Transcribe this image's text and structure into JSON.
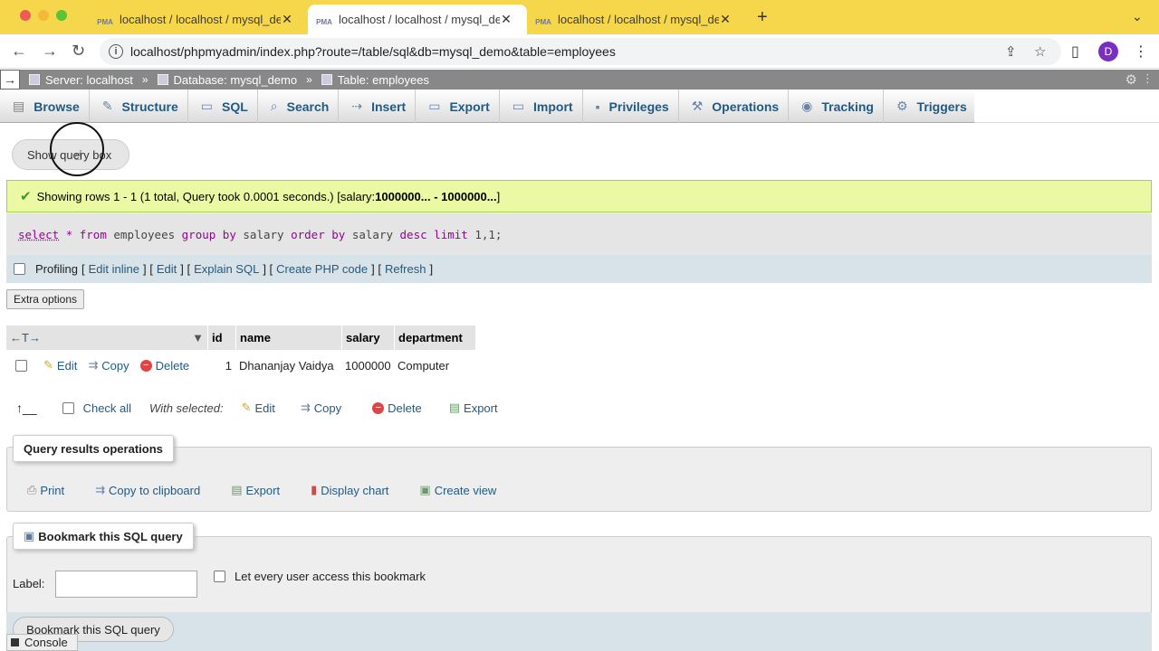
{
  "browser": {
    "tabs": [
      {
        "title": "localhost / localhost / mysql_de",
        "active": false
      },
      {
        "title": "localhost / localhost / mysql_de",
        "active": true
      },
      {
        "title": "localhost / localhost / mysql_de",
        "active": false
      }
    ],
    "favicon_text": "PMA",
    "url": "localhost/phpmyadmin/index.php?route=/table/sql&db=mysql_demo&table=employees",
    "profile_initial": "D"
  },
  "breadcrumb": {
    "server": "Server: localhost",
    "database": "Database: mysql_demo",
    "table": "Table: employees"
  },
  "pma_tabs": [
    "Browse",
    "Structure",
    "SQL",
    "Search",
    "Insert",
    "Export",
    "Import",
    "Privileges",
    "Operations",
    "Tracking",
    "Triggers"
  ],
  "show_query_label": "Show query box",
  "success": {
    "text": "Showing rows 1 - 1 (1 total, Query took 0.0001 seconds.) [salary: ",
    "range": "1000000... - 1000000...",
    "close": "]"
  },
  "sql": {
    "t1": "select",
    "t2": "*",
    "t3": "from",
    "t4": "employees",
    "t5": "group by",
    "t6": "salary",
    "t7": "order by",
    "t8": "salary",
    "t9": "desc",
    "t10": "limit",
    "t11": "1,1;"
  },
  "profiling": {
    "label": "Profiling",
    "edit_inline": "Edit inline",
    "edit": "Edit",
    "explain": "Explain SQL",
    "php": "Create PHP code",
    "refresh": "Refresh"
  },
  "extra_options": "Extra options",
  "table": {
    "columns": [
      "id",
      "name",
      "salary",
      "department"
    ],
    "row": {
      "id": "1",
      "name": "Dhananjay Vaidya",
      "salary": "1000000",
      "department": "Computer"
    },
    "actions": {
      "edit": "Edit",
      "copy": "Copy",
      "delete": "Delete"
    }
  },
  "with_selected": {
    "check_all": "Check all",
    "label": "With selected:",
    "edit": "Edit",
    "copy": "Copy",
    "delete": "Delete",
    "export": "Export"
  },
  "query_ops": {
    "legend": "Query results operations",
    "print": "Print",
    "copy": "Copy to clipboard",
    "export": "Export",
    "chart": "Display chart",
    "view": "Create view"
  },
  "bookmark": {
    "legend": "Bookmark this SQL query",
    "label": "Label:",
    "every_user": "Let every user access this bookmark",
    "button": "Bookmark this SQL query"
  },
  "console": "Console"
}
